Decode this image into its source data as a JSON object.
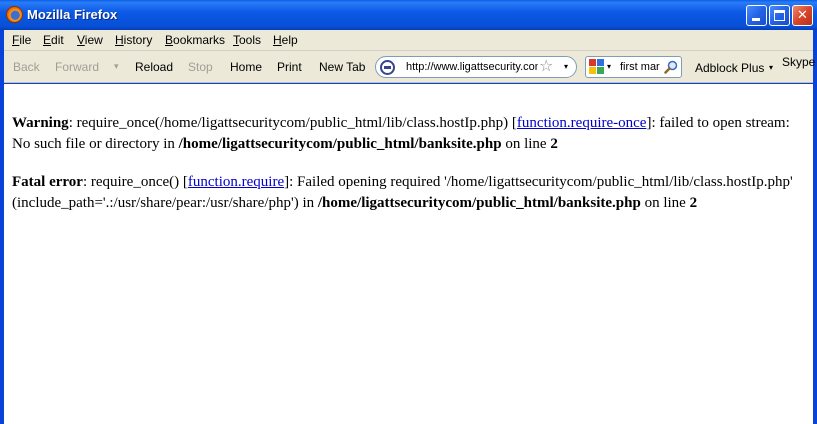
{
  "window": {
    "title": "Mozilla Firefox",
    "minimize_glyph": "",
    "close_glyph": "✕"
  },
  "menu": {
    "items": [
      "File",
      "Edit",
      "View",
      "History",
      "Bookmarks",
      "Tools",
      "Help"
    ]
  },
  "toolbar": {
    "back": "Back",
    "forward": "Forward",
    "forward_dropdown": "▾",
    "reload": "Reload",
    "stop": "Stop",
    "home": "Home",
    "print": "Print",
    "new_tab": "New Tab",
    "url": "http://www.ligattsecurity.com/banksite.php",
    "search_text": "first mar",
    "adblock": "Adblock Plus",
    "skype": "Skype",
    "dropdown_glyph": "▾",
    "star_glyph": "☆"
  },
  "page": {
    "warning": {
      "label": "Warning",
      "text1": ": require_once(/home/ligattsecuritycom/public_html/lib/class.hostIp.php) [",
      "link": "function.require-once",
      "text2": "]: failed to open stream: No such file or directory in ",
      "path": "/home/ligattsecuritycom/public_html/banksite.php",
      "text3": " on line ",
      "line": "2"
    },
    "fatal": {
      "label": "Fatal error",
      "text1": ": require_once() [",
      "link": "function.require",
      "text2": "]: Failed opening required '/home/ligattsecuritycom/public_html/lib/class.hostIp.php' (include_path='.:/usr/share/pear:/usr/share/php') in ",
      "path": "/home/ligattsecuritycom/public_html/banksite.php",
      "text3": " on line ",
      "line": "2"
    }
  },
  "colors": {
    "titlebar": "#0c59e6",
    "chrome": "#ece9d8",
    "link": "#0000cc"
  }
}
